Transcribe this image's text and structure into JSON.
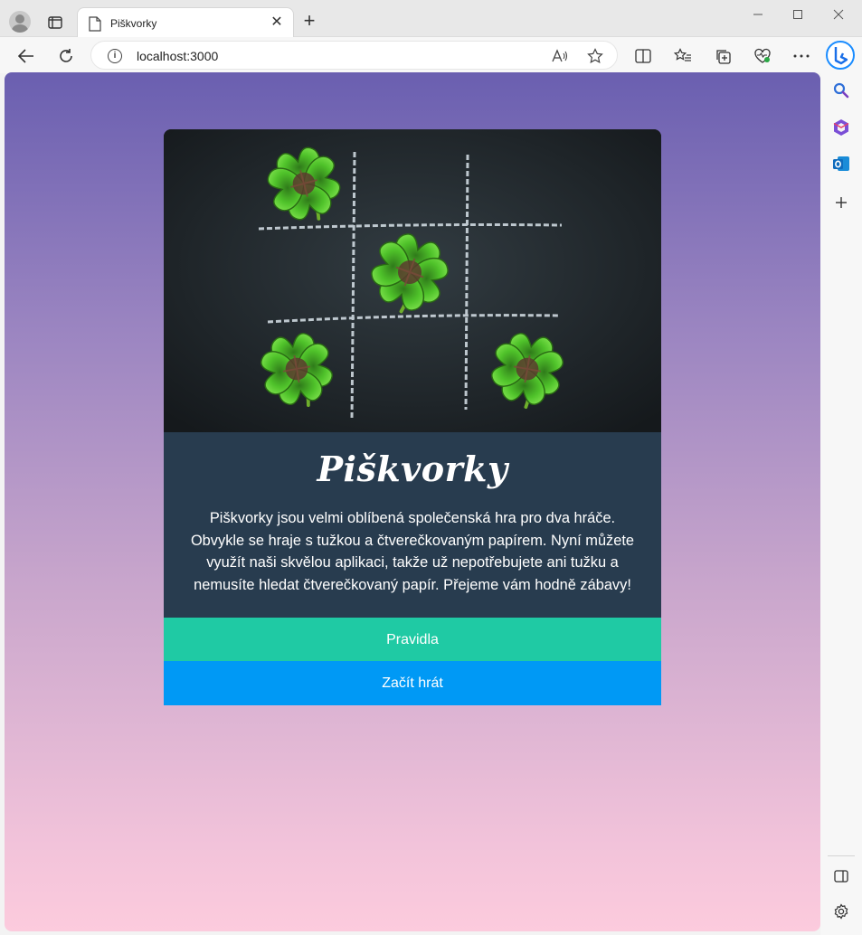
{
  "browser": {
    "tab_title": "Piškvorky",
    "url": "localhost:3000",
    "minimize_glyph": "—",
    "maximize_glyph": "☐",
    "close_glyph": "✕",
    "tab_close_glyph": "✕",
    "new_tab_glyph": "+"
  },
  "page": {
    "title": "Piškvorky",
    "description": "Piškvorky jsou velmi oblíbená společenská hra pro dva hráče. Obvykle se hraje s tužkou a čtverečkovaným papírem. Nyní můžete využít naši skvělou aplikaci, takže už nepotřebujete ani tužku a nemusíte hledat čtverečkovaný papír. Přejeme vám hodně zábavy!",
    "rules_button": "Pravidla",
    "play_button": "Začít hrát"
  },
  "colors": {
    "card_body": "#283c4f",
    "rules_button": "#1fcaa4",
    "play_button": "#0099f5",
    "gradient_top": "#6a5fb0",
    "gradient_bottom": "#fccbdd"
  },
  "icons": [
    "profile-icon",
    "tab-actions-icon",
    "page-icon",
    "back-icon",
    "refresh-icon",
    "info-icon",
    "read-aloud-icon",
    "favorite-star-icon",
    "split-screen-icon",
    "favorites-icon",
    "collections-icon",
    "browser-essentials-icon",
    "more-icon",
    "copilot-icon",
    "search-icon",
    "office-icon",
    "outlook-icon",
    "add-icon",
    "sidebar-toggle-icon",
    "settings-icon"
  ]
}
